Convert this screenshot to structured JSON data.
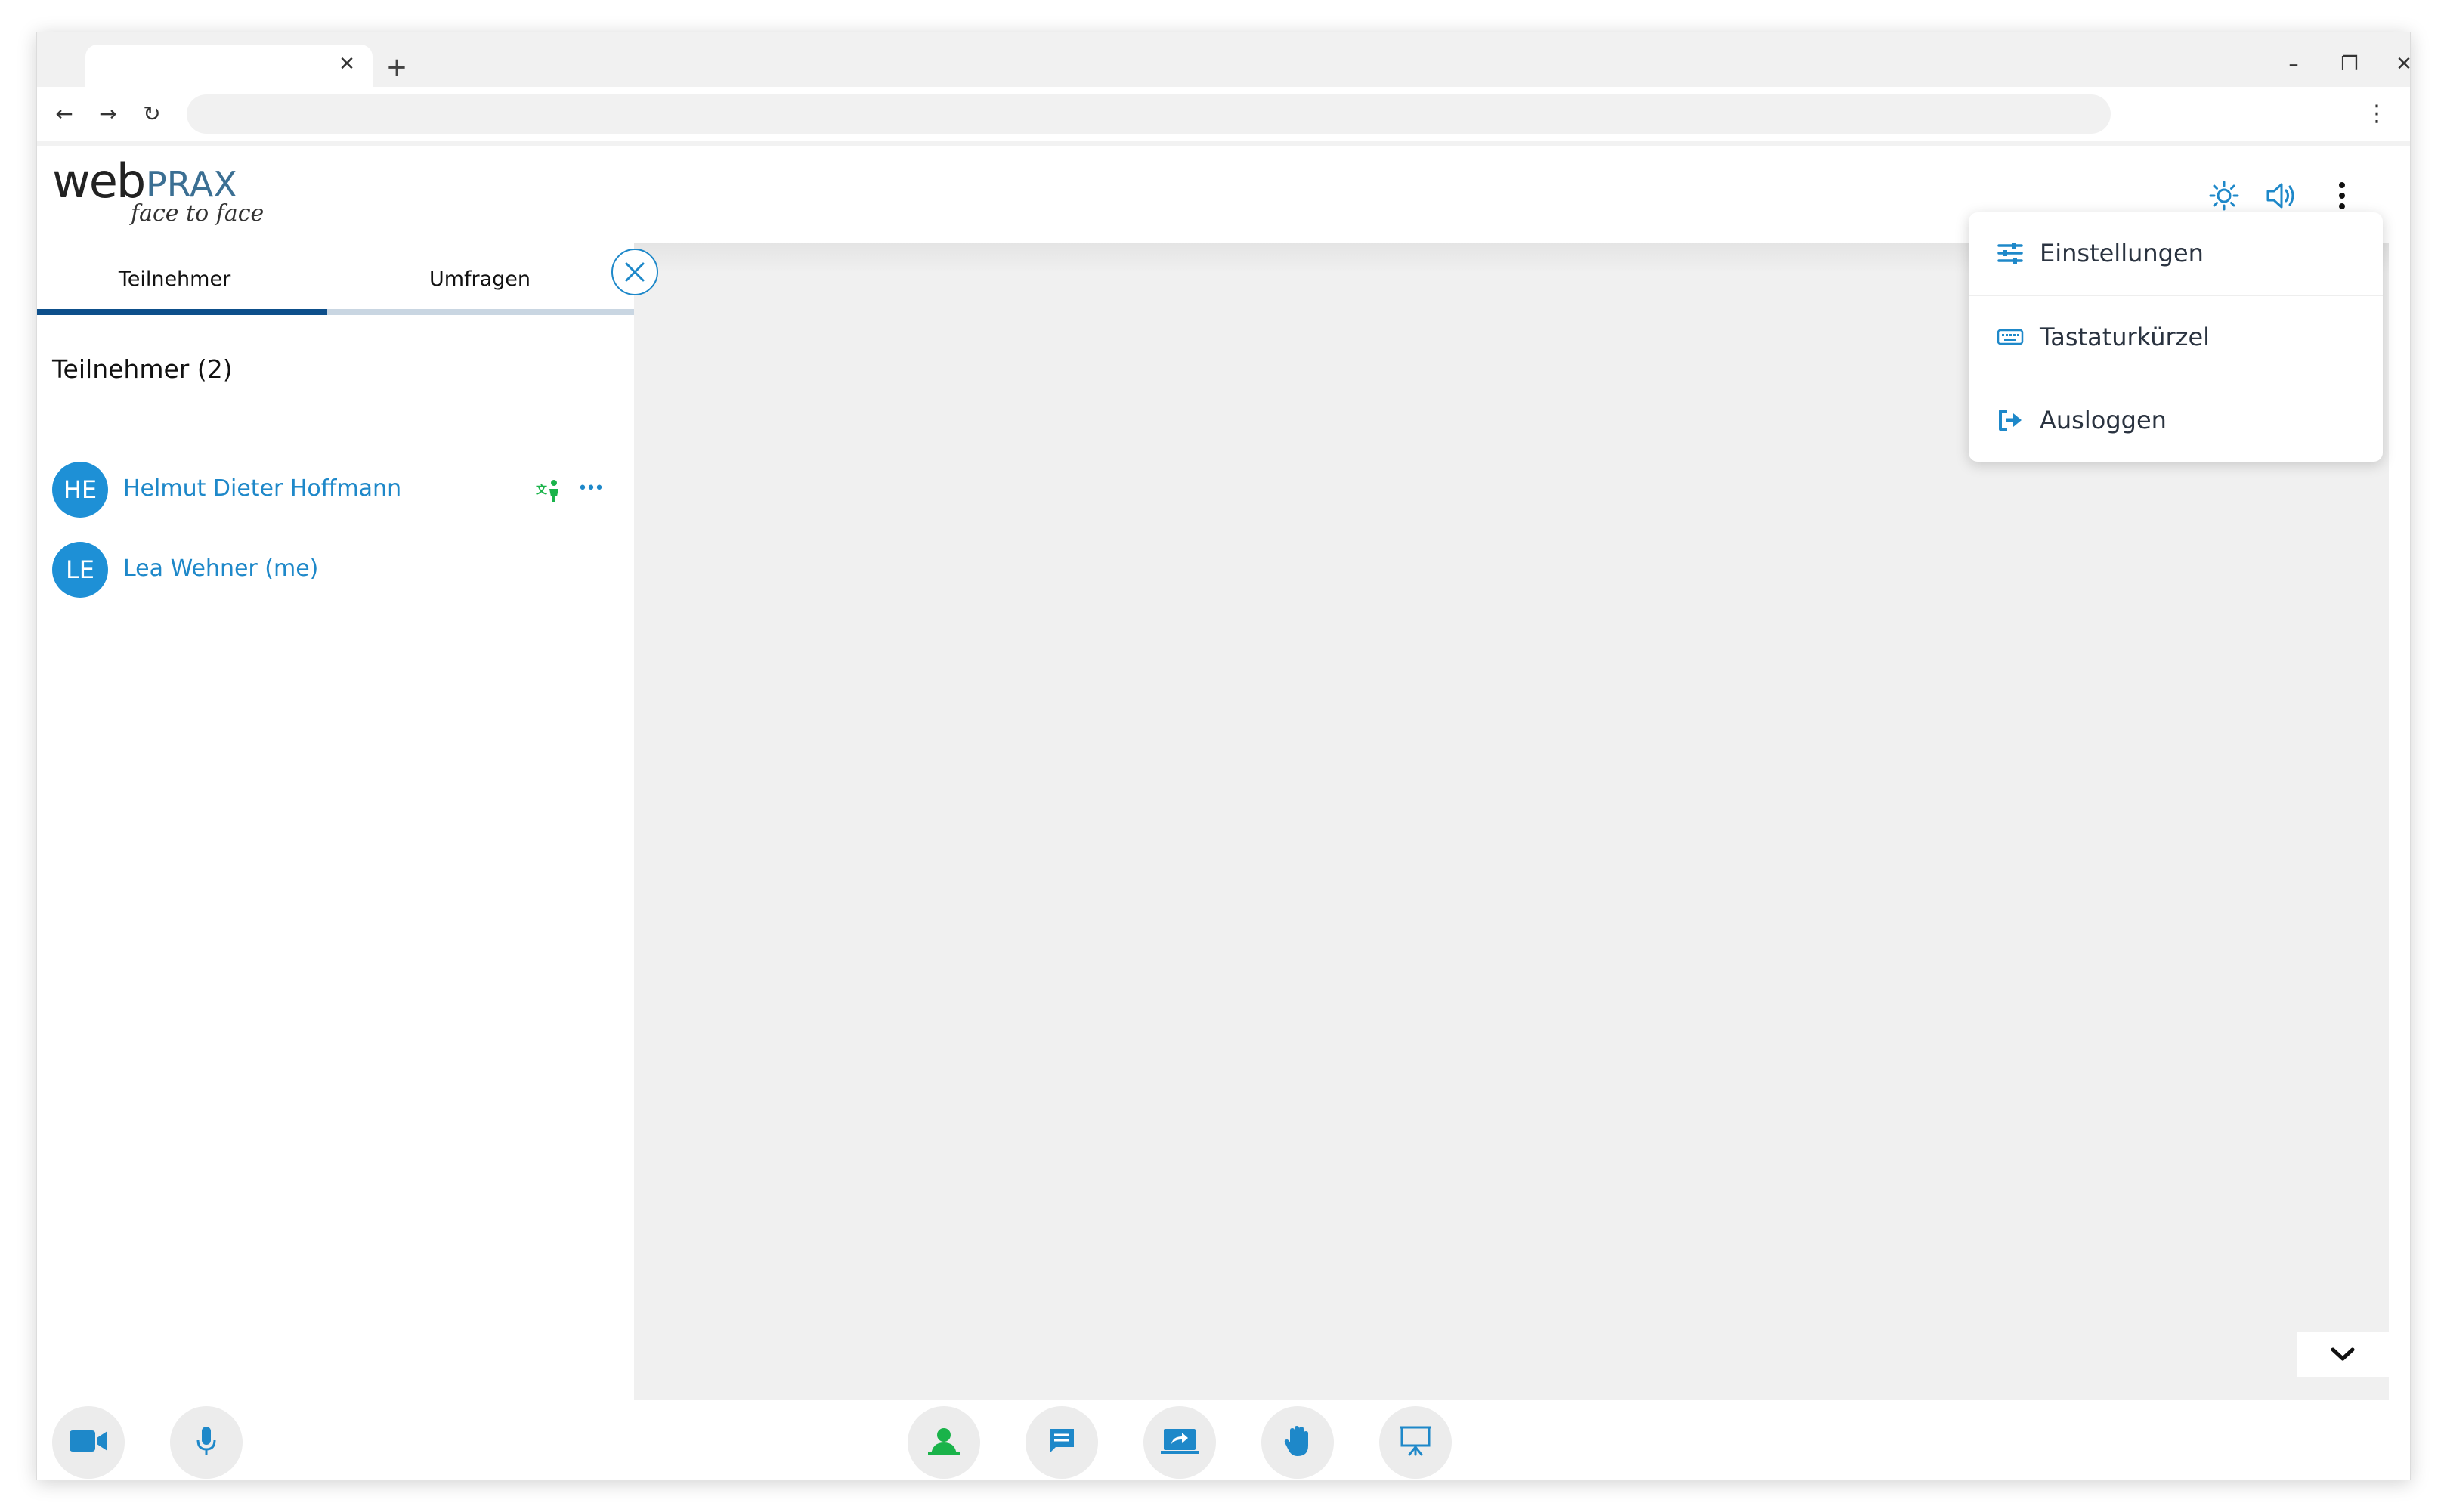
{
  "browser": {
    "tab_title": "",
    "url": "",
    "tab_close_glyph": "✕",
    "new_tab_glyph": "+",
    "back_glyph": "←",
    "forward_glyph": "→",
    "reload_glyph": "↻",
    "minimize_glyph": "–",
    "restore_glyph": "❐",
    "close_glyph": "✕",
    "menu_glyph": "⋮"
  },
  "app": {
    "logo": {
      "main": "web",
      "accent": "PRAX",
      "tagline": "face to face"
    },
    "header_icons": [
      "brightness-icon",
      "speaker-icon",
      "more-vert-icon"
    ]
  },
  "sidebar": {
    "tabs": [
      {
        "label": "Teilnehmer",
        "active": true
      },
      {
        "label": "Umfragen",
        "active": false
      }
    ],
    "list_title": "Teilnehmer (2)",
    "participants": [
      {
        "initials": "HE",
        "name": "Helmut Dieter Hoffmann",
        "status_icon": "translate-person-icon",
        "menu_glyph": "•••"
      },
      {
        "initials": "LE",
        "name": "Lea Wehner (me)"
      }
    ]
  },
  "dropdown": {
    "items": [
      {
        "label": "Einstellungen",
        "icon": "sliders-icon"
      },
      {
        "label": "Tastaturkürzel",
        "icon": "keyboard-icon"
      },
      {
        "label": "Ausloggen",
        "icon": "logout-icon"
      }
    ]
  },
  "toolbar": {
    "left": [
      "video-camera-icon",
      "microphone-icon"
    ],
    "center": [
      "participants-icon",
      "chat-icon",
      "screen-share-icon",
      "raise-hand-icon",
      "presentation-icon"
    ]
  },
  "colors": {
    "accent_blue": "#1e88c9",
    "tab_active": "#0d4f8b",
    "green": "#1ab34a",
    "main_bg": "#f0f0f0"
  }
}
